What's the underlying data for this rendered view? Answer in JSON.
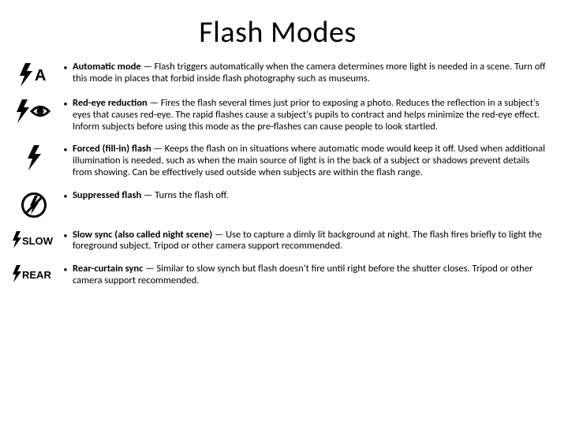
{
  "title": "Flash Modes",
  "modes": [
    {
      "name": "Automatic mode",
      "desc": " — Flash triggers automatically when the camera determines more light is needed in a scene. Turn off this mode  in places that forbid inside flash photography such as museums.",
      "icon_label": "A"
    },
    {
      "name": "Red-eye reduction",
      "desc": " — Fires the flash several times just prior to exposing a photo. Reduces the reflection in a subject's eyes that causes red-eye. The rapid flashes cause a subject's pupils to contract and helps minimize the red-eye effect. Inform subjects before using this mode as the pre-flashes can cause people to look startled."
    },
    {
      "name": "Forced (fill-in) flash",
      "desc": " — Keeps the flash on in situations where automatic mode would keep it off. Used when additional illumination is needed, such as when the main source of light is in the back of a subject or shadows prevent details from showing. Can be effectively used outside when subjects are within the flash range."
    },
    {
      "name": "Suppressed flash",
      "desc": " — Turns the flash off."
    },
    {
      "name": "Slow sync (also called night scene)",
      "desc": " — Use to capture a dimly lit background at night. The flash fires briefly to light the foreground subject. Tripod or other camera support recommended.",
      "icon_label": "SLOW"
    },
    {
      "name": "Rear-curtain sync",
      "desc": " — Similar to slow synch but flash doesn't fire until right before the shutter closes. Tripod or other camera support recommended.",
      "icon_label": "REAR"
    }
  ],
  "bullet": "•"
}
